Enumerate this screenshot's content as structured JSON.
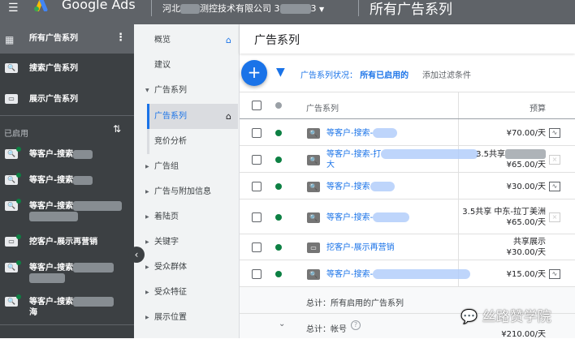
{
  "header": {
    "brand": "Google Ads",
    "account": "河北",
    "account_suffix": "测控技术有限公司",
    "account_id_start": "3",
    "account_id_end": "3",
    "title": "所有广告系列",
    "menu_icon": "hamburger-icon",
    "logo": "google-ads-logo"
  },
  "sidebar": {
    "top_items": [
      {
        "label": "所有广告系列",
        "icon": "grid-icon"
      },
      {
        "label": "搜索广告系列",
        "icon": "search-icon"
      },
      {
        "label": "展示广告系列",
        "icon": "display-icon"
      }
    ],
    "section_label": "已启用",
    "campaigns": [
      {
        "label": "等客户-搜索",
        "icon": "search-icon"
      },
      {
        "label": "等客户-搜索",
        "icon": "search-icon"
      },
      {
        "label": "等客户-搜索",
        "icon": "search-icon"
      },
      {
        "label": "挖客户-展示再营销",
        "icon": "display-icon"
      },
      {
        "label": "等客户-搜索",
        "icon": "search-icon"
      },
      {
        "label": "等客户-搜索",
        "line2": "海",
        "icon": "search-icon"
      }
    ]
  },
  "nav": {
    "items": [
      {
        "label": "概览",
        "home": true
      },
      {
        "label": "建议"
      },
      {
        "label": "广告系列",
        "expanded": true
      },
      {
        "label": "广告系列",
        "selected": true,
        "home": true,
        "sub": true
      },
      {
        "label": "竞价分析",
        "sub": true
      },
      {
        "label": "广告组"
      },
      {
        "label": "广告与附加信息"
      },
      {
        "label": "着陆页"
      },
      {
        "label": "关键字"
      },
      {
        "label": "受众群体"
      },
      {
        "label": "受众特征"
      },
      {
        "label": "展示位置"
      }
    ]
  },
  "main": {
    "title": "广告系列",
    "filter_label": "广告系列状况：",
    "filter_value": "所有已启用的",
    "add_filter": "添加过滤条件",
    "columns": {
      "campaign": "广告系列",
      "budget": "预算"
    },
    "rows": [
      {
        "name": "等客户-搜索-",
        "budget": "¥70.00/天",
        "type": "search"
      },
      {
        "name": "等客户-搜索-打",
        "name2": "大",
        "shared": "3.5共享",
        "budget": "¥65.00/天",
        "type": "search"
      },
      {
        "name": "等客户-搜索",
        "budget": "¥30.00/天",
        "type": "search"
      },
      {
        "name": "等客户-搜索-",
        "shared": "3.5共享 中东-拉丁美洲",
        "budget": "¥65.00/天",
        "type": "search"
      },
      {
        "name": "挖客户-展示再营销",
        "shared": "共享展示",
        "budget": "¥30.00/天",
        "type": "display"
      },
      {
        "name": "等客户-搜索-",
        "budget": "¥15.00/天",
        "type": "search"
      }
    ],
    "total_enabled": "总计：所有启用的广告系列",
    "total_account": "总计：帐号",
    "total_account_budget": "¥210.00/天"
  },
  "watermark": "丝路赞学院",
  "colors": {
    "accent": "#1a73e8",
    "enabled": "#0d8043",
    "header": "#5f6368",
    "sidebar": "#3c4043"
  }
}
